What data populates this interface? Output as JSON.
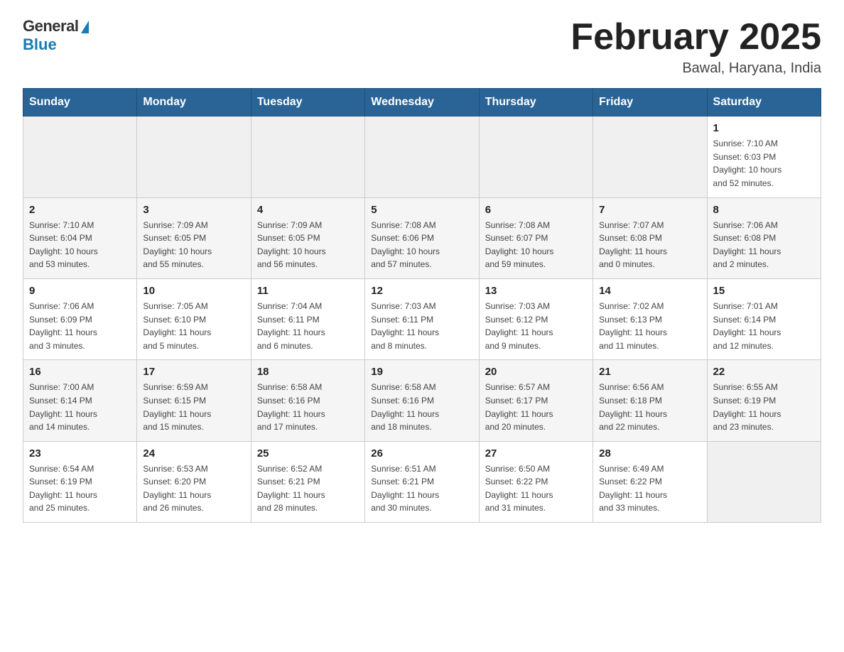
{
  "header": {
    "logo_general": "General",
    "logo_blue": "Blue",
    "month_title": "February 2025",
    "location": "Bawal, Haryana, India"
  },
  "days_of_week": [
    "Sunday",
    "Monday",
    "Tuesday",
    "Wednesday",
    "Thursday",
    "Friday",
    "Saturday"
  ],
  "weeks": [
    [
      {
        "day": "",
        "info": ""
      },
      {
        "day": "",
        "info": ""
      },
      {
        "day": "",
        "info": ""
      },
      {
        "day": "",
        "info": ""
      },
      {
        "day": "",
        "info": ""
      },
      {
        "day": "",
        "info": ""
      },
      {
        "day": "1",
        "info": "Sunrise: 7:10 AM\nSunset: 6:03 PM\nDaylight: 10 hours\nand 52 minutes."
      }
    ],
    [
      {
        "day": "2",
        "info": "Sunrise: 7:10 AM\nSunset: 6:04 PM\nDaylight: 10 hours\nand 53 minutes."
      },
      {
        "day": "3",
        "info": "Sunrise: 7:09 AM\nSunset: 6:05 PM\nDaylight: 10 hours\nand 55 minutes."
      },
      {
        "day": "4",
        "info": "Sunrise: 7:09 AM\nSunset: 6:05 PM\nDaylight: 10 hours\nand 56 minutes."
      },
      {
        "day": "5",
        "info": "Sunrise: 7:08 AM\nSunset: 6:06 PM\nDaylight: 10 hours\nand 57 minutes."
      },
      {
        "day": "6",
        "info": "Sunrise: 7:08 AM\nSunset: 6:07 PM\nDaylight: 10 hours\nand 59 minutes."
      },
      {
        "day": "7",
        "info": "Sunrise: 7:07 AM\nSunset: 6:08 PM\nDaylight: 11 hours\nand 0 minutes."
      },
      {
        "day": "8",
        "info": "Sunrise: 7:06 AM\nSunset: 6:08 PM\nDaylight: 11 hours\nand 2 minutes."
      }
    ],
    [
      {
        "day": "9",
        "info": "Sunrise: 7:06 AM\nSunset: 6:09 PM\nDaylight: 11 hours\nand 3 minutes."
      },
      {
        "day": "10",
        "info": "Sunrise: 7:05 AM\nSunset: 6:10 PM\nDaylight: 11 hours\nand 5 minutes."
      },
      {
        "day": "11",
        "info": "Sunrise: 7:04 AM\nSunset: 6:11 PM\nDaylight: 11 hours\nand 6 minutes."
      },
      {
        "day": "12",
        "info": "Sunrise: 7:03 AM\nSunset: 6:11 PM\nDaylight: 11 hours\nand 8 minutes."
      },
      {
        "day": "13",
        "info": "Sunrise: 7:03 AM\nSunset: 6:12 PM\nDaylight: 11 hours\nand 9 minutes."
      },
      {
        "day": "14",
        "info": "Sunrise: 7:02 AM\nSunset: 6:13 PM\nDaylight: 11 hours\nand 11 minutes."
      },
      {
        "day": "15",
        "info": "Sunrise: 7:01 AM\nSunset: 6:14 PM\nDaylight: 11 hours\nand 12 minutes."
      }
    ],
    [
      {
        "day": "16",
        "info": "Sunrise: 7:00 AM\nSunset: 6:14 PM\nDaylight: 11 hours\nand 14 minutes."
      },
      {
        "day": "17",
        "info": "Sunrise: 6:59 AM\nSunset: 6:15 PM\nDaylight: 11 hours\nand 15 minutes."
      },
      {
        "day": "18",
        "info": "Sunrise: 6:58 AM\nSunset: 6:16 PM\nDaylight: 11 hours\nand 17 minutes."
      },
      {
        "day": "19",
        "info": "Sunrise: 6:58 AM\nSunset: 6:16 PM\nDaylight: 11 hours\nand 18 minutes."
      },
      {
        "day": "20",
        "info": "Sunrise: 6:57 AM\nSunset: 6:17 PM\nDaylight: 11 hours\nand 20 minutes."
      },
      {
        "day": "21",
        "info": "Sunrise: 6:56 AM\nSunset: 6:18 PM\nDaylight: 11 hours\nand 22 minutes."
      },
      {
        "day": "22",
        "info": "Sunrise: 6:55 AM\nSunset: 6:19 PM\nDaylight: 11 hours\nand 23 minutes."
      }
    ],
    [
      {
        "day": "23",
        "info": "Sunrise: 6:54 AM\nSunset: 6:19 PM\nDaylight: 11 hours\nand 25 minutes."
      },
      {
        "day": "24",
        "info": "Sunrise: 6:53 AM\nSunset: 6:20 PM\nDaylight: 11 hours\nand 26 minutes."
      },
      {
        "day": "25",
        "info": "Sunrise: 6:52 AM\nSunset: 6:21 PM\nDaylight: 11 hours\nand 28 minutes."
      },
      {
        "day": "26",
        "info": "Sunrise: 6:51 AM\nSunset: 6:21 PM\nDaylight: 11 hours\nand 30 minutes."
      },
      {
        "day": "27",
        "info": "Sunrise: 6:50 AM\nSunset: 6:22 PM\nDaylight: 11 hours\nand 31 minutes."
      },
      {
        "day": "28",
        "info": "Sunrise: 6:49 AM\nSunset: 6:22 PM\nDaylight: 11 hours\nand 33 minutes."
      },
      {
        "day": "",
        "info": ""
      }
    ]
  ]
}
